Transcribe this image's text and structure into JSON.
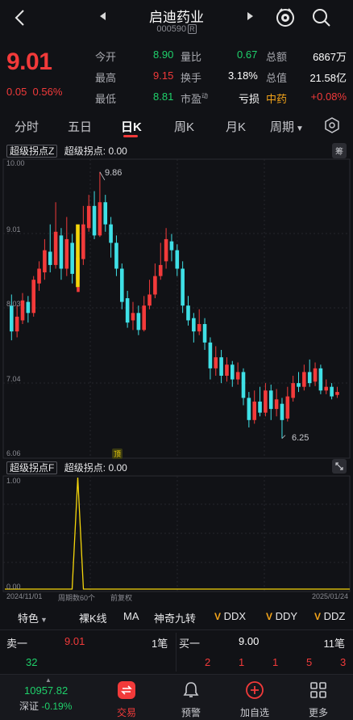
{
  "header": {
    "title": "启迪药业",
    "code": "000590",
    "code_badge": "R"
  },
  "quote": {
    "price": "9.01",
    "change": "0.05",
    "change_pct": "0.56%",
    "rows": [
      {
        "l1": "今开",
        "v1": "8.90",
        "l2": "量比",
        "v2": "0.67",
        "l3": "总额",
        "v3": "6867万"
      },
      {
        "l1": "最高",
        "v1": "9.15",
        "l2": "换手",
        "v2": "3.18%",
        "l3": "总值",
        "v3": "21.58亿"
      },
      {
        "l1": "最低",
        "v1": "8.81",
        "l2": "市盈",
        "l2_sup": "动",
        "v2": "亏损",
        "l3": "中药",
        "v3": "+0.08%"
      }
    ]
  },
  "tabs": [
    "分时",
    "五日",
    "日K",
    "周K",
    "月K",
    "周期"
  ],
  "main_chart": {
    "indicator_name": "超级拐点Z",
    "indicator_value_label": "超级拐点: 0.00",
    "chip_label": "筹",
    "y_ticks": [
      "10.00",
      "9.01",
      "8.03",
      "7.04",
      "6.06"
    ],
    "high_label": "9.86",
    "low_label": "6.25",
    "event_badge": "顶"
  },
  "sub_chart": {
    "indicator_name": "超级拐点F",
    "indicator_value_label": "超级拐点: 0.00",
    "y_ticks": [
      "1.00",
      "0.00"
    ],
    "date_start": "2024/11/01",
    "period_label": "周期数60个",
    "adjust_label": "前复权",
    "date_end": "2025/01/24"
  },
  "toolrow": {
    "special": "特色",
    "items": [
      "裸K线",
      "MA",
      "神奇九转",
      "DDX",
      "DDY",
      "DDZ"
    ]
  },
  "orderbook": {
    "sell_label": "卖一",
    "sell_price": "9.01",
    "sell_count": "1笔",
    "buy_label": "买一",
    "buy_price": "9.00",
    "buy_count": "11笔",
    "sell_qty": "32",
    "buy_qtys": [
      "2",
      "1",
      "1",
      "5",
      "3"
    ]
  },
  "tabbar": {
    "index_value": "10957.82",
    "index_name": "深证",
    "index_pct": "-0.19%",
    "items": [
      "交易",
      "预警",
      "加自选",
      "更多"
    ]
  },
  "colors": {
    "up": "#f23a3a",
    "down": "#1fd16b",
    "candle_down": "#3fe0e6",
    "signal": "#f5d60b",
    "background": "#111216"
  }
}
